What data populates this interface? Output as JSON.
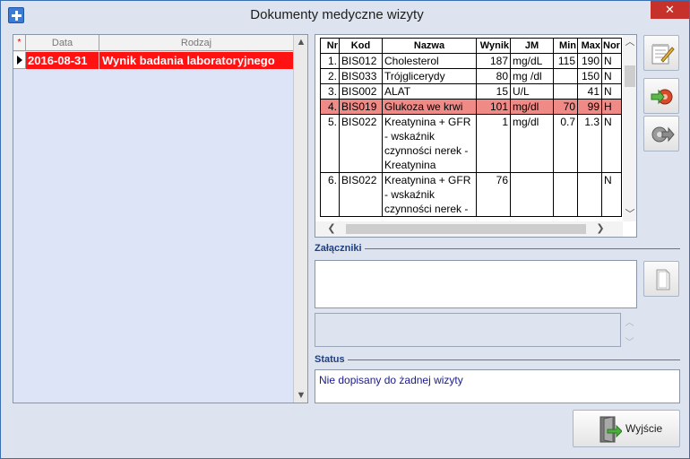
{
  "window": {
    "title": "Dokumenty medyczne wizyty",
    "close_glyph": "✕"
  },
  "documents": {
    "columns": {
      "star": "*",
      "date": "Data",
      "type": "Rodzaj"
    },
    "rows": [
      {
        "date": "2016-08-31",
        "type": "Wynik badania laboratoryjnego"
      }
    ]
  },
  "results": {
    "columns": {
      "nr": "Nr",
      "kod": "Kod",
      "nazwa": "Nazwa",
      "wynik": "Wynik",
      "jm": "JM",
      "min": "Min",
      "max": "Max",
      "nor": "Nor"
    },
    "rows": [
      {
        "nr": "1.",
        "kod": "BIS012",
        "nazwa": "Cholesterol",
        "wynik": "187",
        "jm": "mg/dL",
        "min": "115",
        "max": "190",
        "nor": "N"
      },
      {
        "nr": "2.",
        "kod": "BIS033",
        "nazwa": "Trójglicerydy",
        "wynik": "80",
        "jm": "mg /dl",
        "min": "",
        "max": "150",
        "nor": "N"
      },
      {
        "nr": "3.",
        "kod": "BIS002",
        "nazwa": "ALAT",
        "wynik": "15",
        "jm": "U/L",
        "min": "",
        "max": "41",
        "nor": "N"
      },
      {
        "nr": "4.",
        "kod": "BIS019",
        "nazwa": "Glukoza we krwi",
        "wynik": "101",
        "jm": "mg/dl",
        "min": "70",
        "max": "99",
        "nor": "H"
      },
      {
        "nr": "5.",
        "kod": "BIS022",
        "nazwa": "Kreatynina + GFR - wskaźnik czynności nerek - Kreatynina",
        "wynik": "1",
        "jm": "mg/dl",
        "min": "0.7",
        "max": "1.3",
        "nor": "N"
      },
      {
        "nr": "6.",
        "kod": "BIS022",
        "nazwa": "Kreatynina + GFR - wskaźnik czynności nerek -",
        "wynik": "76",
        "jm": "",
        "min": "",
        "max": "",
        "nor": "N"
      }
    ]
  },
  "sections": {
    "attachments": "Załączniki",
    "status": "Status"
  },
  "status": {
    "text": "Nie dopisany do żadnej wizyty"
  },
  "buttons": {
    "exit": "Wyjście"
  },
  "colors": {
    "selected_row": "#ff1212",
    "highlight_row": "#f08a86",
    "close": "#c7312b",
    "section_text": "#1e3f80"
  }
}
